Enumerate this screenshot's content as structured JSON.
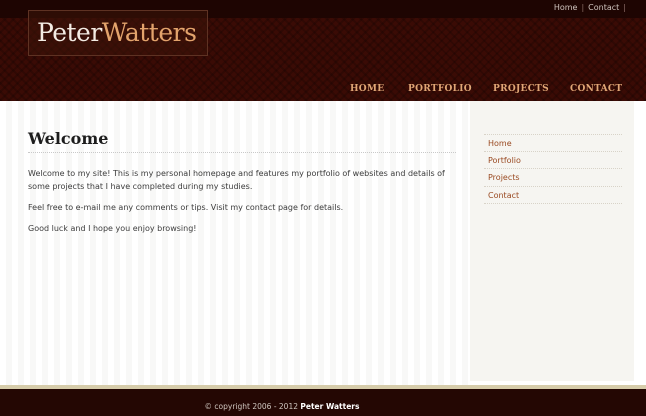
{
  "util_nav": {
    "home": "Home",
    "sep": "|",
    "contact": "Contact",
    "trail": "|"
  },
  "logo": {
    "first": "Peter",
    "last": "Watters"
  },
  "nav": [
    "HOME",
    "PORTFOLIO",
    "PROJECTS",
    "CONTACT"
  ],
  "main": {
    "title": "Welcome",
    "paragraphs": [
      "Welcome to my site! This is my personal homepage and features my portfolio of websites and details of some projects that I have completed during my studies.",
      "Feel free to e-mail me any comments or tips. Visit my contact page for details.",
      "Good luck and I hope you enjoy browsing!"
    ]
  },
  "sidebar": [
    "Home",
    "Portfolio",
    "Projects",
    "Contact"
  ],
  "footer": {
    "copyright": "© copyright 2006 - 2012",
    "name": "Peter Watters"
  },
  "colors": {
    "header_bg": "#3a0b05",
    "nav_accent": "#e0a676",
    "logo_accent": "#e3a36c",
    "link": "#9a4a22",
    "footer_bg": "#240703"
  }
}
